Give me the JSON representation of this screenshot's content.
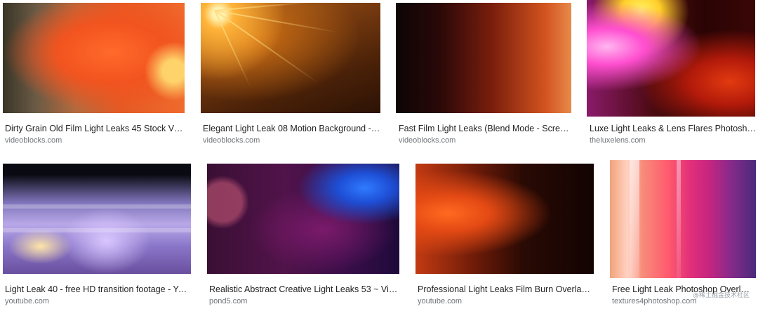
{
  "results": [
    {
      "title": "Dirty Grain Old Film Light Leaks 45 Stock Vid...",
      "source": "videoblocks.com"
    },
    {
      "title": "Elegant Light Leak 08 Motion Background - Vi...",
      "source": "videoblocks.com"
    },
    {
      "title": "Fast Film Light Leaks (Blend Mode - Screen...",
      "source": "videoblocks.com"
    },
    {
      "title": "Luxe Light Leaks & Lens Flares Photosho...",
      "source": "theluxelens.com"
    },
    {
      "title": "Light Leak 40 - free HD transition footage - You...",
      "source": "youtube.com"
    },
    {
      "title": "Realistic Abstract Creative Light Leaks 53 ~ Vide...",
      "source": "pond5.com"
    },
    {
      "title": "Professional Light Leaks Film Burn Overlay - ...",
      "source": "youtube.com"
    },
    {
      "title": "Free Light Leak Photoshop Overlay...",
      "source": "textures4photoshop.com"
    }
  ],
  "watermark": "@稀土掘金技术社区"
}
